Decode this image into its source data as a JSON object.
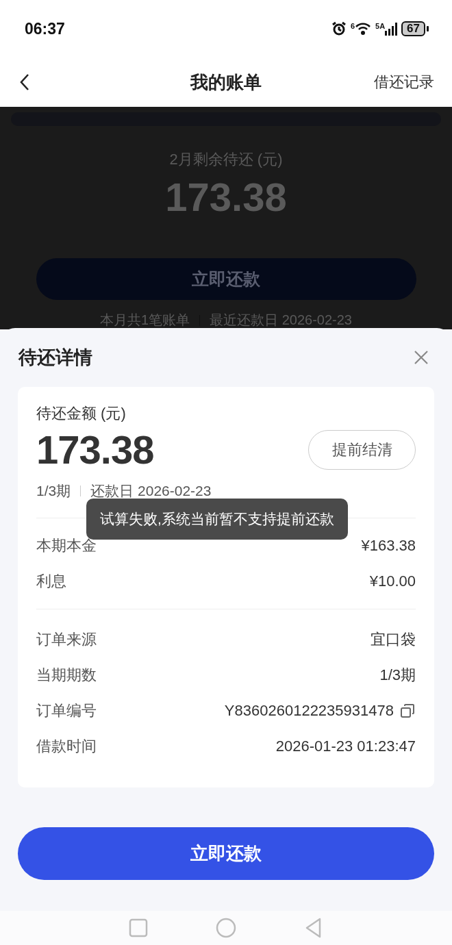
{
  "status_bar": {
    "time": "06:37",
    "wifi_badge": "6",
    "network": "5A",
    "battery": "67"
  },
  "header": {
    "title": "我的账单",
    "action": "借还记录"
  },
  "background": {
    "label": "2月剩余待还 (元)",
    "amount": "173.38",
    "button": "立即还款",
    "summary": [
      "本月共1笔账单",
      "最近还款日 2026-02-23"
    ]
  },
  "sheet": {
    "title": "待还详情",
    "amount_label": "待还金额 (元)",
    "amount": "173.38",
    "settle_button": "提前结清",
    "period": "1/3期",
    "due_date": "还款日 2026-02-23",
    "toast": "试算失败,系统当前暂不支持提前还款",
    "groups": [
      [
        {
          "label": "本期本金",
          "value": "¥163.38",
          "kind": "plain"
        },
        {
          "label": "利息",
          "value": "¥10.00",
          "kind": "plain"
        }
      ],
      [
        {
          "label": "订单来源",
          "value": "宜口袋",
          "kind": "plain"
        },
        {
          "label": "当期期数",
          "value": "1/3期",
          "kind": "plain"
        },
        {
          "label": "订单编号",
          "value": "Y8360260122235931478",
          "kind": "copy"
        },
        {
          "label": "借款时间",
          "value": "2026-01-23 01:23:47",
          "kind": "plain"
        }
      ]
    ],
    "pay_button": "立即还款"
  }
}
